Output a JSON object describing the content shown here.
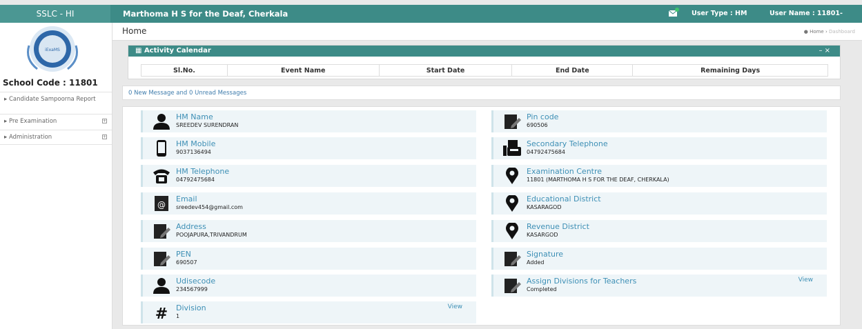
{
  "topbar": {
    "brand": "SSLC - HI",
    "school_name": "Marthoma H S for the Deaf, Cherkala",
    "user_type": "User Type : HM",
    "user_name": "User Name : 11801-"
  },
  "sidebar": {
    "school_code": "School Code : 11801",
    "items": [
      {
        "label": "▸ Candidate Sampoorna Report",
        "icon": "none"
      },
      {
        "label": "▸ Pre Examination",
        "icon": "plus-box-icon"
      },
      {
        "label": "▸ Administration",
        "icon": "plus-box-icon"
      }
    ]
  },
  "header": {
    "title": "Home",
    "crumb_home": "Home",
    "crumb_sep": "›",
    "crumb_current": "Dashboard"
  },
  "calendar": {
    "title": "Activity Calendar",
    "controls": "–  ×",
    "columns": [
      "Sl.No.",
      "Event Name",
      "Start Date",
      "End Date",
      "Remaining Days"
    ]
  },
  "messages": "0 New Message and 0 Unread Messages",
  "info_left": [
    {
      "label": "HM Name",
      "value": "SREEDEV SURENDRAN",
      "icon": "person-icon"
    },
    {
      "label": "HM Mobile",
      "value": "9037136494",
      "icon": "mobile-icon"
    },
    {
      "label": "HM Telephone",
      "value": "04792475684",
      "icon": "telephone-icon"
    },
    {
      "label": "Email",
      "value": "sreedev454@gmail.com",
      "icon": "email-icon"
    },
    {
      "label": "Address",
      "value": "POOJAPURA,TRIVANDRUM",
      "icon": "edit-icon"
    },
    {
      "label": "PEN",
      "value": "690507",
      "icon": "edit-icon"
    },
    {
      "label": "Udisecode",
      "value": "234567999",
      "icon": "person-icon"
    },
    {
      "label": "Division",
      "value": "1",
      "icon": "hash-icon",
      "link": "View"
    }
  ],
  "info_right": [
    {
      "label": "Pin code",
      "value": "690506",
      "icon": "edit-icon"
    },
    {
      "label": "Secondary Telephone",
      "value": "04792475684",
      "icon": "fax-icon"
    },
    {
      "label": "Examination Centre",
      "value": "11801 (MARTHOMA H S FOR THE DEAF, CHERKALA)",
      "icon": "map-marker-icon"
    },
    {
      "label": "Educational District",
      "value": "KASARAGOD",
      "icon": "map-marker-icon"
    },
    {
      "label": "Revenue District",
      "value": "KASARGOD",
      "icon": "map-marker-icon"
    },
    {
      "label": "Signature",
      "value": "Added",
      "icon": "edit-icon"
    },
    {
      "label": "Assign Divisions for Teachers",
      "value": "Completed",
      "icon": "edit-icon",
      "link": "View"
    }
  ],
  "colors": {
    "accent": "#3d8b87",
    "link": "#3d8fb5",
    "card_bg": "#eef5f8"
  }
}
